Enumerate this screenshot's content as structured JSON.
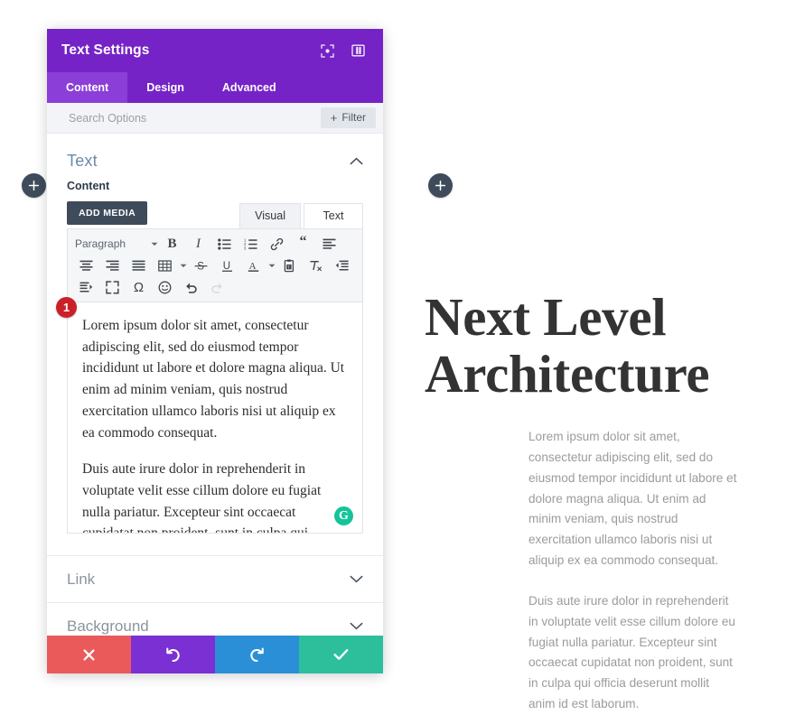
{
  "canvas": {
    "add_left_icon": "plus-icon",
    "add_right_icon": "plus-icon"
  },
  "modal": {
    "title": "Text Settings",
    "header_icons": [
      {
        "name": "focus-target-icon",
        "label": ""
      },
      {
        "name": "layout-panel-icon",
        "label": ""
      }
    ],
    "tabs": [
      {
        "label": "Content",
        "active": true
      },
      {
        "label": "Design",
        "active": false
      },
      {
        "label": "Advanced",
        "active": false
      }
    ],
    "search": {
      "placeholder": "Search Options",
      "value": "",
      "filter_label": "Filter",
      "filter_plus": "+"
    },
    "section": {
      "title": "Text",
      "collapse_icon": "chevron-up-icon",
      "field_label": "Content"
    },
    "editor": {
      "add_media_label": "ADD MEDIA",
      "mode_tabs": [
        {
          "label": "Visual",
          "active": true
        },
        {
          "label": "Text",
          "active": false
        }
      ],
      "format_select": "Paragraph",
      "toolbar_row1": [
        "bold-icon",
        "italic-icon",
        "bulleted-list-icon",
        "numbered-list-icon",
        "link-icon",
        "blockquote-icon",
        "align-left-icon"
      ],
      "toolbar_row2": [
        "align-center-icon",
        "align-right-icon",
        "justify-icon",
        "table-icon",
        "strikethrough-icon",
        "underline-icon",
        "text-color-icon",
        "paste-as-text-icon",
        "clear-formatting-icon",
        "outdent-icon"
      ],
      "toolbar_row3": [
        "indent-icon",
        "fullscreen-icon",
        "special-character-icon",
        "emoji-icon",
        "undo-icon",
        "redo-icon"
      ],
      "paragraphs": [
        "Lorem ipsum dolor sit amet, consectetur adipiscing elit, sed do eiusmod tempor incididunt ut labore et dolore magna aliqua. Ut enim ad minim veniam, quis nostrud exercitation ullamco laboris nisi ut aliquip ex ea commodo consequat.",
        "Duis aute irure dolor in reprehenderit in voluptate velit esse cillum dolore eu fugiat nulla pariatur. Excepteur sint occaecat cupidatat non proident, sunt in culpa qui officia deserunt mollit anim id est laborum."
      ],
      "grammarly_badge": "G"
    },
    "step_badge": "1",
    "accordions": [
      {
        "label": "Link",
        "icon": "chevron-down-icon"
      },
      {
        "label": "Background",
        "icon": "chevron-down-icon"
      }
    ],
    "footer": [
      {
        "name": "cancel-button",
        "icon": "close-icon",
        "color": "#eb5a5a"
      },
      {
        "name": "undo-button",
        "icon": "undo-icon",
        "color": "#7b30d4"
      },
      {
        "name": "redo-button",
        "icon": "redo-icon",
        "color": "#2a8fd6"
      },
      {
        "name": "save-button",
        "icon": "check-icon",
        "color": "#2dbf9c"
      }
    ]
  },
  "preview": {
    "heading": "Next Level Architecture",
    "paragraphs": [
      "Lorem ipsum dolor sit amet, consectetur adipiscing elit, sed do eiusmod tempor incididunt ut labore et dolore magna aliqua. Ut enim ad minim veniam, quis nostrud exercitation ullamco laboris nisi ut aliquip ex ea commodo consequat.",
      "Duis aute irure dolor in reprehenderit in voluptate velit esse cillum dolore eu fugiat nulla pariatur. Excepteur sint occaecat cupidatat non proident, sunt in culpa qui officia deserunt mollit anim id est laborum."
    ]
  },
  "colors": {
    "brand_purple": "#7523c6",
    "tab_active": "#8b3ed8",
    "dark_navy": "#3e4b5b",
    "section_title": "#6c8ba6",
    "badge_red": "#cb2027",
    "grammarly_green": "#15c39a"
  }
}
